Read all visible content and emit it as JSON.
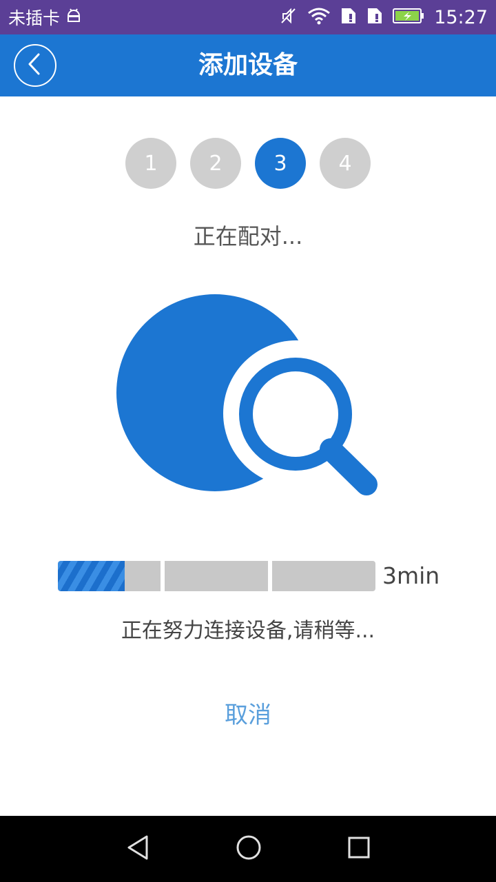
{
  "status_bar": {
    "carrier": "未插卡",
    "time": "15:27",
    "icons": [
      "android-icon",
      "mute-icon",
      "wifi-icon",
      "sim-1-icon",
      "sim-2-icon",
      "battery-icon"
    ]
  },
  "header": {
    "title": "添加设备",
    "back_icon": "chevron-left-icon"
  },
  "steps": {
    "items": [
      "1",
      "2",
      "3",
      "4"
    ],
    "current": "3"
  },
  "pairing": {
    "text": "正在配对..."
  },
  "illustration": {
    "icon": "search-device-icon"
  },
  "progress": {
    "fraction": 0.21,
    "remaining": "3min",
    "status_text": "正在努力连接设备,请稍等..."
  },
  "actions": {
    "cancel_label": "取消"
  },
  "nav_bar": {
    "icons": [
      "back-triangle-icon",
      "home-circle-icon",
      "recents-square-icon"
    ]
  },
  "colors": {
    "status_bar": "#5b3f96",
    "primary": "#1c76d2",
    "inactive_step": "#cfcfcf",
    "cancel_text": "#5a9fdc"
  }
}
